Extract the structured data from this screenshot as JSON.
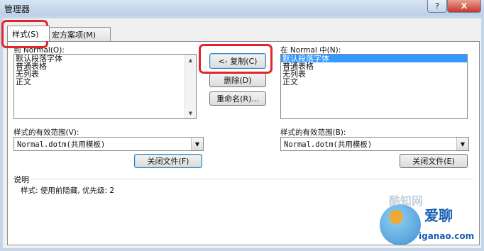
{
  "window": {
    "title": "管理器",
    "help_glyph": "?",
    "close_glyph": "X"
  },
  "tabs": [
    {
      "label": "样式(S)"
    },
    {
      "label": "宏方案项(M)"
    }
  ],
  "left": {
    "label": "到 Normal(O):",
    "items": [
      "默认段落字体",
      "普通表格",
      "无列表",
      "正文"
    ],
    "scope_label": "样式的有效范围(V):",
    "scope_value": "Normal.dotm(共用模板)",
    "close_file_button": "关闭文件(F)"
  },
  "middle": {
    "copy_button": "<- 复制(C)",
    "delete_button": "删除(D)",
    "rename_button": "重命名(R)..."
  },
  "right": {
    "label": "在 Normal 中(N):",
    "items": [
      "默认段落字体",
      "普通表格",
      "无列表",
      "正文"
    ],
    "selected_index": 0,
    "scope_label": "样式的有效范围(B):",
    "scope_value": "Normal.dotm(共用模板)",
    "close_file_button": "关闭文件(E)"
  },
  "description": {
    "title": "说明",
    "text": "样式: 使用前隐藏, 优先级: 2"
  },
  "watermark": {
    "text_top": "爱聊",
    "text_bottom": "iganao.com",
    "text_bg": "酷知网"
  },
  "colors": {
    "highlight": "#e0262a",
    "selection": "#3399ff"
  }
}
